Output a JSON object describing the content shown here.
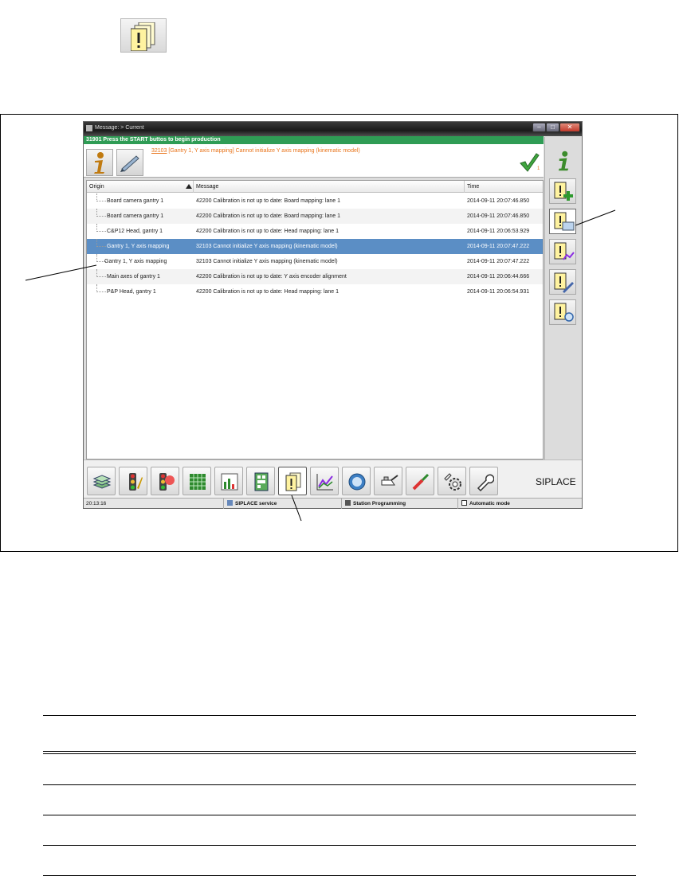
{
  "window": {
    "title": "Message: > Current",
    "status_message": "31901 Press the START buttos to begin production",
    "current_message": {
      "code": "32103",
      "text": " [Gantry 1, Y axis mapping] Cannot initialize Y axis mapping (kinematic model)"
    },
    "ack_count": "1"
  },
  "list": {
    "headers": {
      "origin": "Origin",
      "message": "Message",
      "time": "Time"
    },
    "rows": [
      {
        "origin": "Board camera gantry 1",
        "message": "42200 Calibration is not up to date: Board mapping: lane 1",
        "time": "2014-09-11 20:07:46.850"
      },
      {
        "origin": "Board camera gantry 1",
        "message": "42200 Calibration is not up to date: Board mapping: lane 1",
        "time": "2014-09-11 20:07:46.850"
      },
      {
        "origin": "C&P12 Head, gantry 1",
        "message": "42200 Calibration is not up to date: Head mapping: lane 1",
        "time": "2014-09-11 20:06:53.929"
      },
      {
        "origin": "Gantry 1, Y axis mapping",
        "message": "32103 Cannot initialize Y axis mapping (kinematic model)",
        "time": "2014-09-11 20:07:47.222"
      },
      {
        "origin": "Gantry 1, Y axis mapping",
        "message": "32103 Cannot initialize Y axis mapping (kinematic model)",
        "time": "2014-09-11 20:07:47.222"
      },
      {
        "origin": "Main axes of gantry 1",
        "message": "42200 Calibration is not up to date: Y axis encoder alignment",
        "time": "2014-09-11 20:06:44.666"
      },
      {
        "origin": "P&P Head, gantry 1",
        "message": "42200 Calibration is not up to date: Head mapping: lane 1",
        "time": "2014-09-11 20:06:54.931"
      }
    ]
  },
  "toolbar": {
    "brand": "SIPLACE"
  },
  "statusbar": {
    "time": "20:13:16",
    "service": "SIPLACE service",
    "programming": "Station Programming",
    "mode": "Automatic mode"
  },
  "colors": {
    "accent_green": "#2f9c55",
    "selection_blue": "#5b8ec5",
    "message_orange": "#e8731a"
  }
}
